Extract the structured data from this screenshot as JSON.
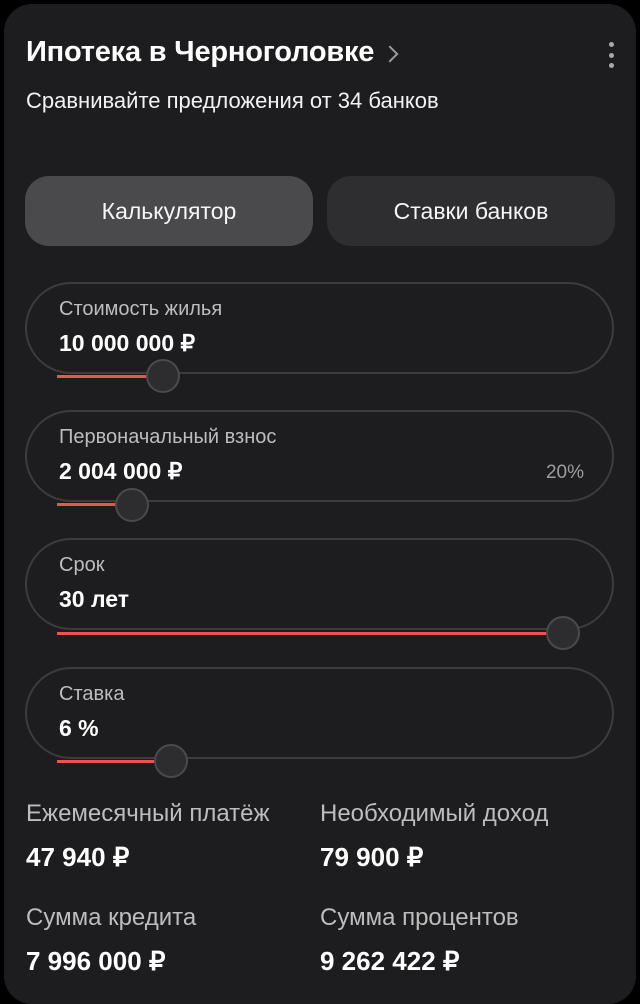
{
  "header": {
    "title": "Ипотека в Черноголовке",
    "subtitle": "Сравнивайте предложения от 34 банков"
  },
  "tabs": [
    {
      "label": "Калькулятор",
      "active": true
    },
    {
      "label": "Ставки банков",
      "active": false
    }
  ],
  "fields": [
    {
      "label": "Стоимость жилья",
      "value": "10 000 000 ₽",
      "extra": "",
      "slider_fraction": 0.19
    },
    {
      "label": "Первоначальный взнос",
      "value": "2 004 000 ₽",
      "extra": "20%",
      "slider_fraction": 0.12
    },
    {
      "label": "Срок",
      "value": "30 лет",
      "extra": "",
      "slider_fraction": 1.0
    },
    {
      "label": "Ставка",
      "value": "6 %",
      "extra": "",
      "slider_fraction": 0.2
    }
  ],
  "results": {
    "monthly_payment_label": "Ежемесячный платёж",
    "monthly_payment_value": "47 940 ₽",
    "required_income_label": "Необходимый доход",
    "required_income_value": "79 900 ₽",
    "loan_amount_label": "Сумма кредита",
    "loan_amount_value": "7 996 000 ₽",
    "interest_amount_label": "Сумма процентов",
    "interest_amount_value": "9 262 422 ₽"
  },
  "colors": {
    "accent": "#e8574a",
    "card_bg": "#1d1d1f"
  },
  "icons": {
    "chevron": "chevron-right-icon",
    "menu": "more-vertical-icon"
  }
}
